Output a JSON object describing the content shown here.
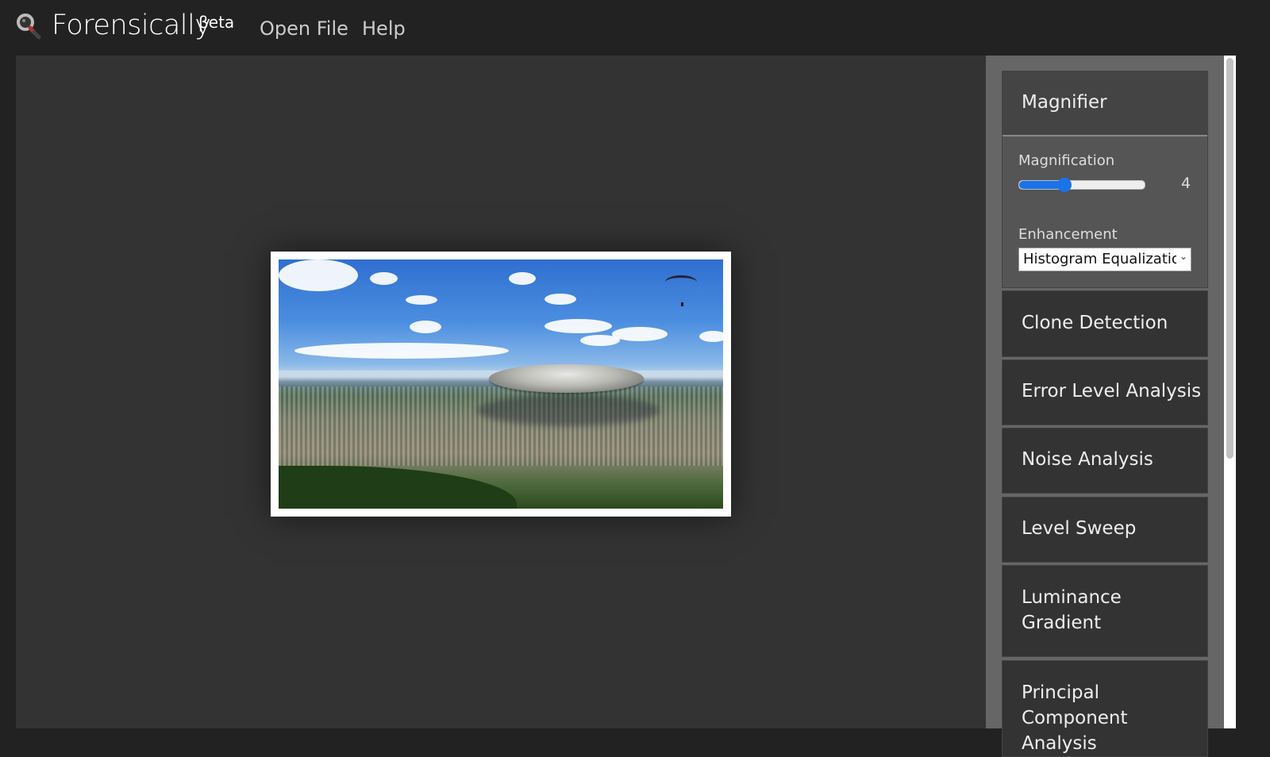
{
  "app": {
    "title": "Forensically",
    "badge": "βeta",
    "logo_icon": "magnifying-glass-icon"
  },
  "nav": {
    "open_file": "Open File",
    "help": "Help"
  },
  "viewer": {
    "image_description": "Aerial city landscape with a flying saucer and a paraglider in a blue cloudy sky"
  },
  "sidebar": {
    "active_tool": {
      "title": "Magnifier",
      "magnification_label": "Magnification",
      "magnification_value": "4",
      "magnification_fraction": 0.36,
      "enhancement_label": "Enhancement",
      "enhancement_value": "Histogram Equalization"
    },
    "tools": [
      {
        "label": "Clone Detection"
      },
      {
        "label": "Error Level Analysis"
      },
      {
        "label": "Noise Analysis"
      },
      {
        "label": "Level Sweep"
      },
      {
        "label": "Luminance Gradient"
      },
      {
        "label": "Principal Component Analysis"
      }
    ]
  },
  "colors": {
    "accent": "#1a73e8",
    "background": "#222222",
    "viewer_bg": "#333333",
    "sidebar_bg": "#666666",
    "tool_bg": "#333333"
  }
}
